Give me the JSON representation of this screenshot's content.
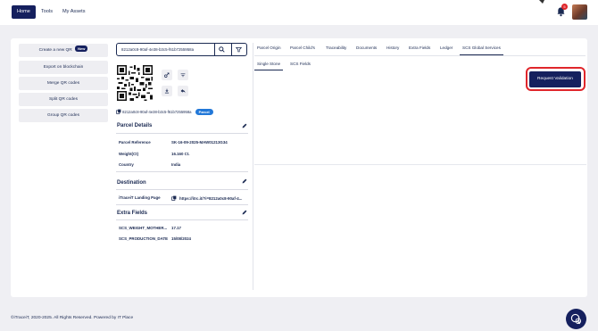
{
  "nav": {
    "home": "Home",
    "tools": "Tools",
    "assets": "My Assets",
    "notification_count": "5"
  },
  "sidebar": {
    "create_label": "Create a new QR",
    "new_badge": "New",
    "items": [
      "Export on blockchain",
      "Merge QR codes",
      "Split QR codes",
      "Group QR codes"
    ]
  },
  "search": {
    "value": "8212a0c8-90af-4e38-b3c5-f61b7255958a"
  },
  "asset": {
    "code": "8212a0c8-90af-4e38-b3c5-f61b7255958a",
    "type_badge": "Parcel"
  },
  "parcel_details": {
    "title": "Parcel Details",
    "rows": [
      {
        "label": "Parcel Reference",
        "value": "SK-16-09-2025-MAW01213G34"
      },
      {
        "label": "Weight(Ct)",
        "value": "16.160 Ct."
      },
      {
        "label": "Country",
        "value": "India"
      }
    ]
  },
  "destination": {
    "title": "Destination",
    "label": "iTraceiT Landing Page",
    "link": "https://itrc.it/?i=8212a0c8-90af-4..."
  },
  "extra_fields": {
    "title": "Extra Fields",
    "rows": [
      {
        "label": "SCS_WEIGHT_MOTHER...",
        "value": "17.17"
      },
      {
        "label": "SCS_PRODUCTION_DATE",
        "value": "15/08/2024"
      }
    ]
  },
  "tabs": [
    "Parcel Origin",
    "Parcel Child's",
    "Traceability",
    "Documents",
    "History",
    "Extra Fields",
    "Ledger",
    "SCS Global Services"
  ],
  "active_tab": "SCS Global Services",
  "subtabs": [
    "Single Stone",
    "SCS Fields"
  ],
  "active_subtab": "Single Stone",
  "action": {
    "request_validation": "Request Validation"
  },
  "footer": {
    "text": "©iTraceiT, 2020-2025. All Rights Reserved. Powered by IT Place"
  },
  "colors": {
    "primary": "#15205e",
    "accent_red": "#e0262b",
    "badge_blue": "#2278d8"
  }
}
